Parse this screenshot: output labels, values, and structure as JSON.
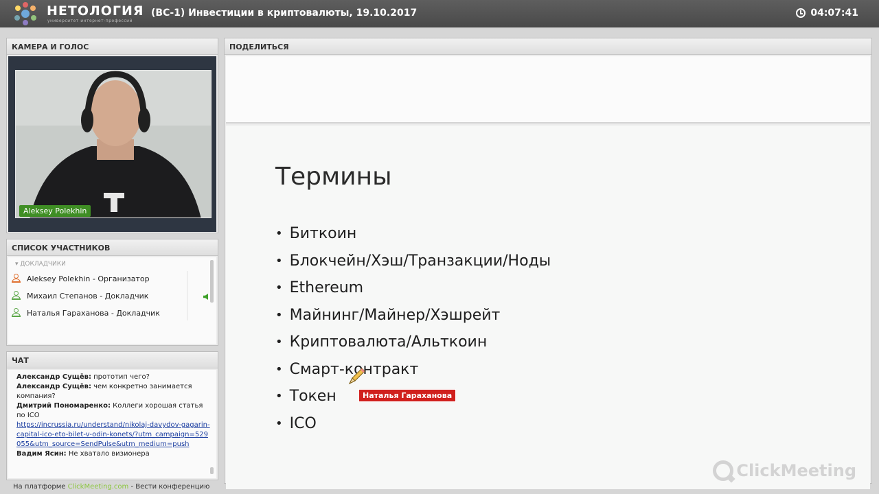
{
  "app": {
    "brand": "НЕТОЛОГИЯ",
    "brand_sub": "университет интернет-профессий",
    "session_title": "(ВС-1) Инвестиции в криптовалюты, 19.10.2017",
    "timer": "04:07:41"
  },
  "camera": {
    "header": "КАМЕРА И ГОЛОС",
    "person_name": "Aleksey Polekhin"
  },
  "participants": {
    "header": "СПИСОК УЧАСТНИКОВ",
    "group": "ДОКЛАДЧИКИ",
    "rows": [
      {
        "name": "Aleksey Polekhin - Организатор",
        "role": "org"
      },
      {
        "name": "Михаил Степанов - Докладчик",
        "role": "spk"
      },
      {
        "name": "Наталья Гараханова - Докладчик",
        "role": "spk"
      }
    ]
  },
  "chat": {
    "header": "ЧАТ",
    "messages": [
      {
        "author": "Александр Сущёв:",
        "text": " прототип чего?"
      },
      {
        "author": "Александр Сущёв:",
        "text": " чем конкретно занимается компания?"
      },
      {
        "author": "Дмитрий Пономаренко:",
        "text": " Коллеги хорошая статья по ICO",
        "link": "https://incrussia.ru/understand/nikolaj-davydov-gagarin-capital-ico-eto-bilet-v-odin-konets/?utm_campaign=529055&utm_source=SendPulse&utm_medium=push"
      },
      {
        "author": "Вадим Ясин:",
        "text": " Не хватало визионера"
      }
    ]
  },
  "share": {
    "header": "ПОДЕЛИТЬСЯ",
    "slide_title": "Термины",
    "bullets": [
      "Биткоин",
      "Блокчейн/Хэш/Транзакции/Ноды",
      "Ethereum",
      "Майнинг/Майнер/Хэшрейт",
      "Криптовалюта/Альткоин",
      "Смарт-контракт",
      "Токен",
      "ICO"
    ],
    "cursor_label": "Наталья Гараханова",
    "watermark": "ClickMeeting"
  },
  "footer": {
    "prefix": "На платформе ",
    "platform": "ClickMeeting.com",
    "suffix": " - Вести конференцию"
  },
  "colors": {
    "accent_green": "#3f8e24",
    "cursor_red": "#d0201d",
    "link_blue": "#1a3da0"
  }
}
